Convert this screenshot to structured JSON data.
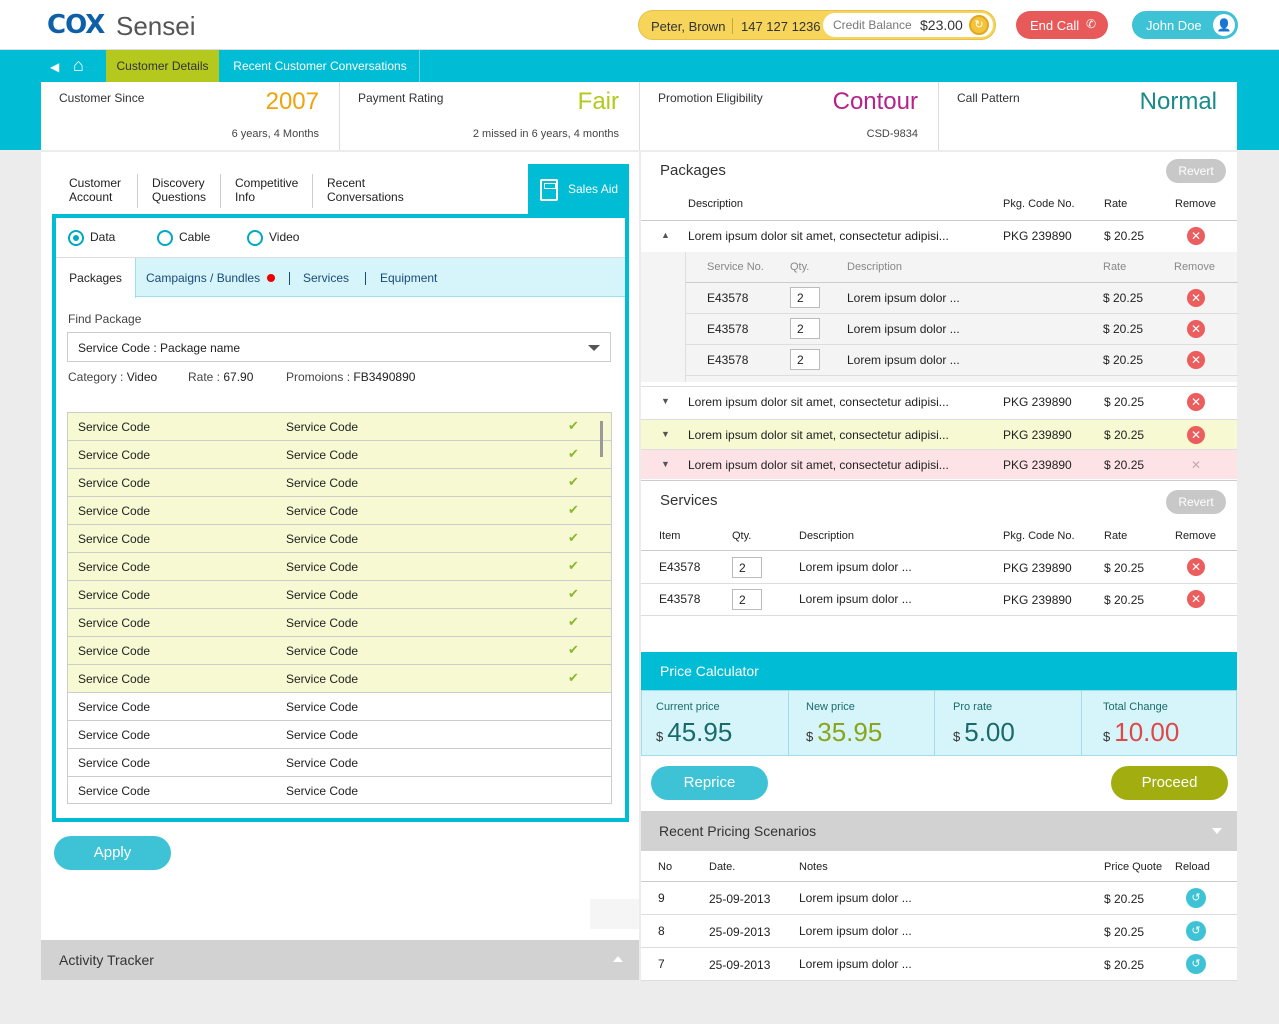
{
  "header": {
    "brand": "COX",
    "app_name": "Sensei",
    "caller_name": "Peter, Brown",
    "caller_phone": "147 127 1236",
    "credit_label": "Credit Balance",
    "credit_value": "$23.00",
    "end_call_label": "End Call",
    "user_name": "John Doe"
  },
  "nav": {
    "tabs": [
      {
        "label": "Customer Details"
      },
      {
        "label": "Recent Customer Conversations"
      }
    ]
  },
  "summary": [
    {
      "label": "Customer Since",
      "value": "2007",
      "sub": "6 years, 4 Months",
      "color": "#f0a30a"
    },
    {
      "label": "Payment Rating",
      "value": "Fair",
      "sub": "2 missed in 6 years, 4 months",
      "color": "#b5c81d"
    },
    {
      "label": "Promotion Eligibility",
      "value": "Contour",
      "sub": "CSD-9834",
      "color": "#b5228c"
    },
    {
      "label": "Call Pattern",
      "value": "Normal",
      "sub": "",
      "color": "#1a8a8a"
    }
  ],
  "left": {
    "tabs": [
      {
        "line1": "Customer",
        "line2": "Account"
      },
      {
        "line1": "Discovery",
        "line2": "Questions"
      },
      {
        "line1": "Competitive",
        "line2": "Info"
      },
      {
        "line1": "Recent",
        "line2": "Conversations"
      }
    ],
    "sales_aid_label": "Sales Aid",
    "radios": [
      {
        "label": "Data",
        "selected": true
      },
      {
        "label": "Cable",
        "selected": false
      },
      {
        "label": "Video",
        "selected": false
      }
    ],
    "subtabs": [
      "Packages",
      "Campaigns / Bundles",
      "Services",
      "Equipment"
    ],
    "find_label": "Find Package",
    "find_value": "Service Code : Package name",
    "category_label": "Category :",
    "category_value": "Video",
    "rate_label": "Rate :",
    "rate_value": "67.90",
    "promo_label": "Promoions :",
    "promo_value": "FB3490890",
    "rows": [
      {
        "c1": "Service Code",
        "c2": "Service Code",
        "selected": true
      },
      {
        "c1": "Service Code",
        "c2": "Service Code",
        "selected": true
      },
      {
        "c1": "Service Code",
        "c2": "Service Code",
        "selected": true
      },
      {
        "c1": "Service Code",
        "c2": "Service Code",
        "selected": true
      },
      {
        "c1": "Service Code",
        "c2": "Service Code",
        "selected": true
      },
      {
        "c1": "Service Code",
        "c2": "Service Code",
        "selected": true
      },
      {
        "c1": "Service Code",
        "c2": "Service Code",
        "selected": true
      },
      {
        "c1": "Service Code",
        "c2": "Service Code",
        "selected": true
      },
      {
        "c1": "Service Code",
        "c2": "Service Code",
        "selected": true
      },
      {
        "c1": "Service Code",
        "c2": "Service Code",
        "selected": true
      },
      {
        "c1": "Service Code",
        "c2": "Service Code",
        "selected": false
      },
      {
        "c1": "Service Code",
        "c2": "Service Code",
        "selected": false
      },
      {
        "c1": "Service Code",
        "c2": "Service Code",
        "selected": false
      },
      {
        "c1": "Service Code",
        "c2": "Service Code",
        "selected": false
      }
    ],
    "apply_label": "Apply",
    "tracker_label": "Activity Tracker"
  },
  "packages": {
    "title": "Packages",
    "revert_label": "Revert",
    "headers": [
      "Description",
      "Pkg. Code No.",
      "Rate",
      "Remove"
    ],
    "sub_headers": [
      "Service No.",
      "Qty.",
      "Description",
      "Rate",
      "Remove"
    ],
    "first": {
      "desc": "Lorem ipsum dolor sit amet, consectetur adipisi...",
      "code": "PKG 239890",
      "rate": "$ 20.25"
    },
    "sub_rows": [
      {
        "no": "E43578",
        "qty": "2",
        "desc": "Lorem ipsum dolor ...",
        "rate": "$ 20.25"
      },
      {
        "no": "E43578",
        "qty": "2",
        "desc": "Lorem ipsum dolor ...",
        "rate": "$ 20.25"
      },
      {
        "no": "E43578",
        "qty": "2",
        "desc": "Lorem ipsum dolor ...",
        "rate": "$ 20.25"
      }
    ],
    "rows": [
      {
        "desc": "Lorem ipsum dolor sit amet, consectetur adipisi...",
        "code": "PKG 239890",
        "rate": "$ 20.25",
        "state": "normal"
      },
      {
        "desc": "Lorem ipsum dolor sit amet, consectetur adipisi...",
        "code": "PKG 239890",
        "rate": "$ 20.25",
        "state": "added"
      },
      {
        "desc": "Lorem ipsum dolor sit amet, consectetur adipisi...",
        "code": "PKG 239890",
        "rate": "$ 20.25",
        "state": "removed"
      }
    ]
  },
  "services": {
    "title": "Services",
    "revert_label": "Revert",
    "headers": [
      "Item",
      "Qty.",
      "Description",
      "Pkg. Code No.",
      "Rate",
      "Remove"
    ],
    "rows": [
      {
        "item": "E43578",
        "qty": "2",
        "desc": "Lorem ipsum dolor ...",
        "code": "PKG 239890",
        "rate": "$ 20.25"
      },
      {
        "item": "E43578",
        "qty": "2",
        "desc": "Lorem ipsum dolor ...",
        "code": "PKG 239890",
        "rate": "$ 20.25"
      }
    ]
  },
  "calculator": {
    "title": "Price Calculator",
    "currency": "$",
    "cells": [
      {
        "label": "Current price",
        "value": "45.95",
        "color": "#1a6a6a"
      },
      {
        "label": "New price",
        "value": "35.95",
        "color": "#8aa51a"
      },
      {
        "label": "Pro rate",
        "value": "5.00",
        "color": "#1a6a6a"
      },
      {
        "label": "Total Change",
        "value": "10.00",
        "color": "#e04848"
      }
    ],
    "reprice_label": "Reprice",
    "proceed_label": "Proceed"
  },
  "scenarios": {
    "title": "Recent Pricing Scenarios",
    "headers": [
      "No",
      "Date.",
      "Notes",
      "Price Quote",
      "Reload"
    ],
    "rows": [
      {
        "no": "9",
        "date": "25-09-2013",
        "notes": "Lorem ipsum dolor ...",
        "quote": "$ 20.25"
      },
      {
        "no": "8",
        "date": "25-09-2013",
        "notes": "Lorem ipsum dolor ...",
        "quote": "$ 20.25"
      },
      {
        "no": "7",
        "date": "25-09-2013",
        "notes": "Lorem ipsum dolor ...",
        "quote": "$ 20.25"
      }
    ]
  },
  "colors": {
    "accent": "#00bcd4",
    "brand": "#0d5fa8",
    "added_row": "#f6f9d2",
    "removed_row": "#fde3e6"
  }
}
